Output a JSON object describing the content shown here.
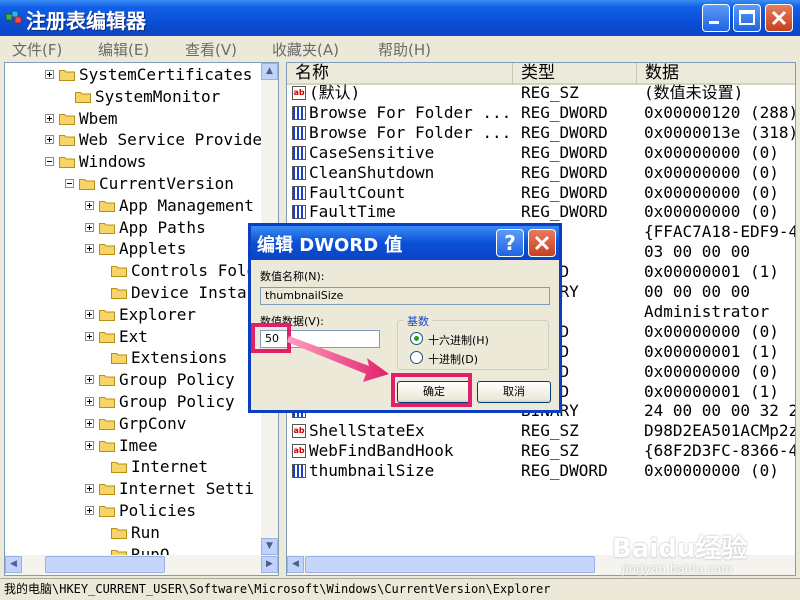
{
  "window": {
    "title": "注册表编辑器"
  },
  "menu": [
    "文件(F)",
    "编辑(E)",
    "查看(V)",
    "收藏夹(A)",
    "帮助(H)"
  ],
  "tree": [
    {
      "label": "SystemCertificates",
      "expander": true
    },
    {
      "label": "SystemMonitor",
      "expander": false
    },
    {
      "label": "Wbem",
      "expander": true
    },
    {
      "label": "Web Service Provide",
      "expander": true
    },
    {
      "label": "Windows",
      "expander": "open"
    },
    {
      "label": "CurrentVersion",
      "expander": "open"
    },
    {
      "label": "App Management",
      "expander": true
    },
    {
      "label": "App Paths",
      "expander": true
    },
    {
      "label": "Applets",
      "expander": true
    },
    {
      "label": "Controls Folde",
      "expander": false
    },
    {
      "label": "Device Instal",
      "expander": false
    },
    {
      "label": "Explorer",
      "expander": true
    },
    {
      "label": "Ext",
      "expander": true
    },
    {
      "label": "Extensions",
      "expander": false
    },
    {
      "label": "Group Policy",
      "expander": true
    },
    {
      "label": "Group Policy",
      "expander": true
    },
    {
      "label": "GrpConv",
      "expander": true
    },
    {
      "label": "Imee",
      "expander": true
    },
    {
      "label": "Internet",
      "expander": false
    },
    {
      "label": "Internet Setti",
      "expander": true
    },
    {
      "label": "Policies",
      "expander": true
    },
    {
      "label": "Run",
      "expander": false
    },
    {
      "label": "RunO",
      "expander": false
    }
  ],
  "columns": {
    "name": "名称",
    "type": "类型",
    "data": "数据"
  },
  "values": [
    {
      "icon": "string",
      "name": "(默认)",
      "type": "REG_SZ",
      "data": "(数值未设置)"
    },
    {
      "icon": "binary",
      "name": "Browse For Folder ...",
      "type": "REG_DWORD",
      "data": "0x00000120 (288)"
    },
    {
      "icon": "binary",
      "name": "Browse For Folder ...",
      "type": "REG_DWORD",
      "data": "0x0000013e (318)"
    },
    {
      "icon": "binary",
      "name": "CaseSensitive",
      "type": "REG_DWORD",
      "data": "0x00000000 (0)"
    },
    {
      "icon": "binary",
      "name": "CleanShutdown",
      "type": "REG_DWORD",
      "data": "0x00000000 (0)"
    },
    {
      "icon": "binary",
      "name": "FaultCount",
      "type": "REG_DWORD",
      "data": "0x00000000 (0)"
    },
    {
      "icon": "binary",
      "name": "FaultTime",
      "type": "REG_DWORD",
      "data": "0x00000000 (0)"
    },
    {
      "icon": "string",
      "name": "",
      "type": "SZ",
      "data": "{FFAC7A18-EDF9-4"
    },
    {
      "icon": "binary",
      "name": "",
      "type": "NONE",
      "data": "03 00 00 00"
    },
    {
      "icon": "binary",
      "name": "",
      "type": "DWORD",
      "data": "0x00000001 (1)"
    },
    {
      "icon": "binary",
      "name": "",
      "type": "BINARY",
      "data": "00 00 00 00"
    },
    {
      "icon": "string",
      "name": "",
      "type": "SZ",
      "data": "Administrator"
    },
    {
      "icon": "binary",
      "name": "",
      "type": "DWORD",
      "data": "0x00000000 (0)"
    },
    {
      "icon": "binary",
      "name": "",
      "type": "DWORD",
      "data": "0x00000001 (1)"
    },
    {
      "icon": "binary",
      "name": "",
      "type": "DWORD",
      "data": "0x00000000 (0)"
    },
    {
      "icon": "binary",
      "name": "",
      "type": "DWORD",
      "data": "0x00000001 (1)"
    },
    {
      "icon": "binary",
      "name": "",
      "type": "BINARY",
      "data": "24 00 00 00 32 2"
    },
    {
      "icon": "string",
      "name": "ShellStateEx",
      "type": "REG_SZ",
      "data": "D98D2EA501ACMp2z"
    },
    {
      "icon": "string",
      "name": "WebFindBandHook",
      "type": "REG_SZ",
      "data": "{68F2D3FC-8366-4"
    },
    {
      "icon": "binary",
      "name": "thumbnailSize",
      "type": "REG_DWORD",
      "data": "0x00000000 (0)"
    }
  ],
  "status": "我的电脑\\HKEY_CURRENT_USER\\Software\\Microsoft\\Windows\\CurrentVersion\\Explorer",
  "dialog": {
    "title": "编辑 DWORD 值",
    "help_label": "?",
    "name_label": "数值名称(N):",
    "name_value": "thumbnailSize",
    "data_label": "数值数据(V):",
    "data_value": "50",
    "base_label": "基数",
    "hex_label": "十六进制(H)",
    "dec_label": "十进制(D)",
    "ok_label": "确定",
    "cancel_label": "取消"
  },
  "watermark": {
    "main": "Baidu经验",
    "sub": "jingyan.baidu.com"
  },
  "colors": {
    "titlebar": "#0b4fd6",
    "highlight": "#e0206a",
    "close": "#c6401f"
  }
}
